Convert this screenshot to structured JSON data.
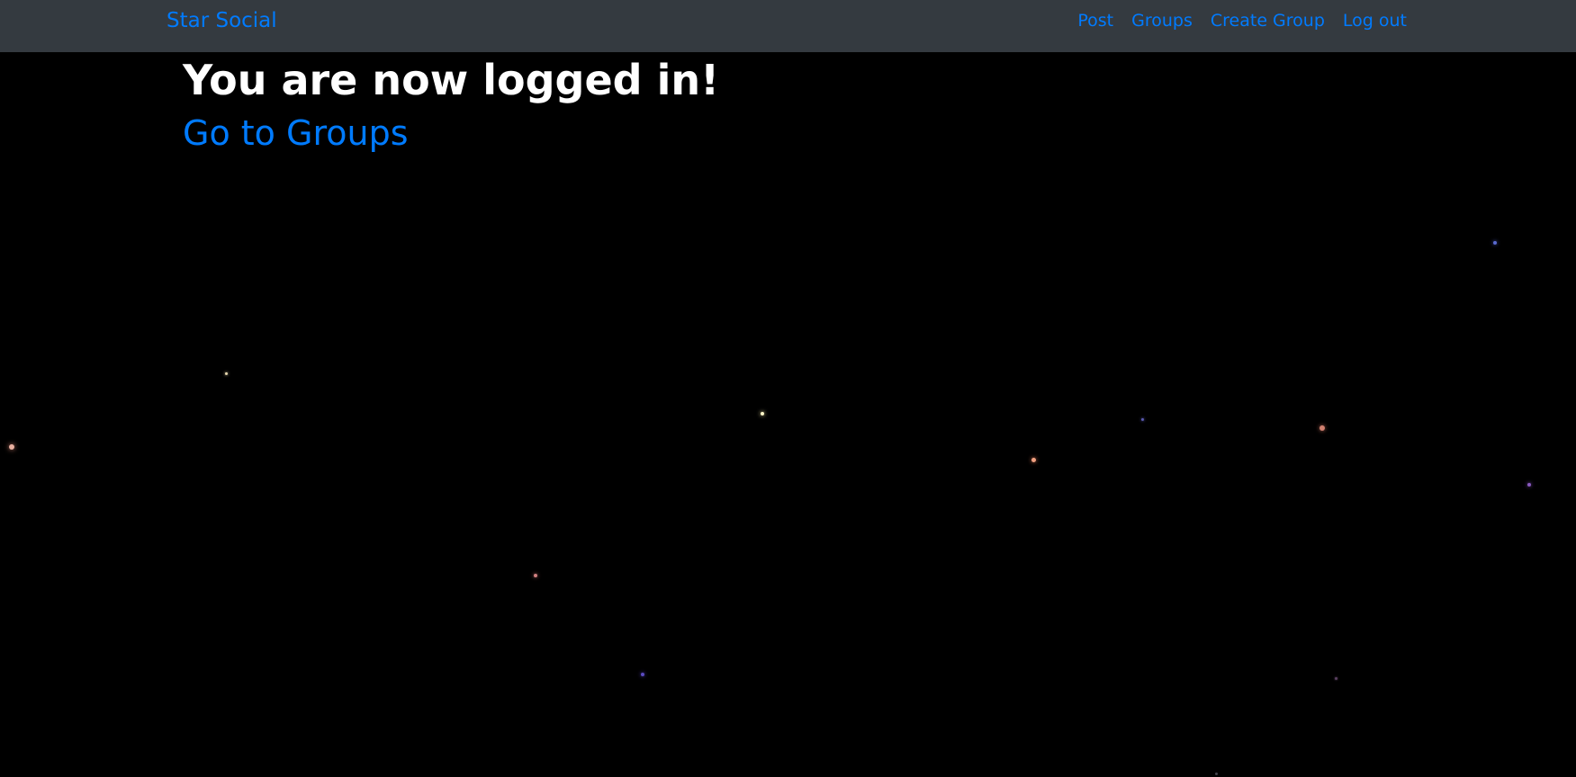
{
  "navbar": {
    "brand": "Star Social",
    "links": [
      "Post",
      "Groups",
      "Create Group",
      "Log out"
    ]
  },
  "main": {
    "headline": "You are now logged in!",
    "groups_link": "Go to Groups"
  },
  "colors": {
    "navbar_bg": "#343a40",
    "page_bg": "#000000",
    "link": "#007bff",
    "headline": "#ffffff"
  }
}
